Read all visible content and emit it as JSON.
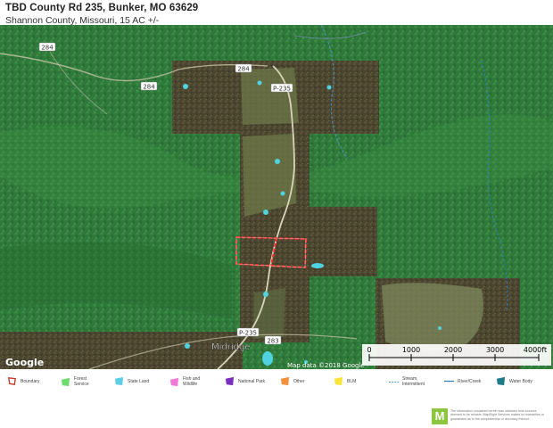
{
  "header": {
    "title": "TBD County Rd 235, Bunker, MO 63629",
    "subtitle": "Shannon County, Missouri, 15 AC +/-"
  },
  "map": {
    "road_labels": [
      "284",
      "284",
      "284",
      "P-235",
      "P-235",
      "283"
    ],
    "place_label": "Midridge",
    "branding": "Google",
    "attribution": "Map data ©2018 Google",
    "scale": {
      "ticks": [
        "0",
        "1000",
        "2000",
        "3000",
        "4000ft"
      ]
    },
    "colors": {
      "boundary": "#ff2a2a",
      "forest": "#2f7a3a",
      "cleared": "#5a4a35",
      "water": "#4fd3e0"
    }
  },
  "legend": {
    "items": [
      {
        "label": "Boundary",
        "icon": "boundary-icon",
        "color": "#c0392b"
      },
      {
        "label": "Forest Service",
        "icon": "forest-service-icon",
        "color": "#6fdc6f"
      },
      {
        "label": "State Land",
        "icon": "state-land-icon",
        "color": "#5ccfe6"
      },
      {
        "label": "Fish and Wildlife",
        "icon": "fish-wildlife-icon",
        "color": "#f07ad8"
      },
      {
        "label": "National Park",
        "icon": "national-park-icon",
        "color": "#7b2fbe"
      },
      {
        "label": "Other",
        "icon": "other-icon",
        "color": "#f5913e"
      },
      {
        "label": "BLM",
        "icon": "blm-icon",
        "color": "#f7e53a"
      },
      {
        "label": "Stream, Intermittent",
        "icon": "stream-intermittent-icon",
        "color": "#4a90c2"
      },
      {
        "label": "River/Creek",
        "icon": "river-creek-icon",
        "color": "#2f7fb8"
      },
      {
        "label": "Water Body",
        "icon": "water-body-icon",
        "color": "#1f7a8c"
      }
    ]
  },
  "footer": {
    "logo": "M",
    "disclaimer": "The information contained herein was obtained from sources deemed to be reliable. MapRight Services makes no warranties or guarantees as to the completeness or accuracy thereof."
  }
}
